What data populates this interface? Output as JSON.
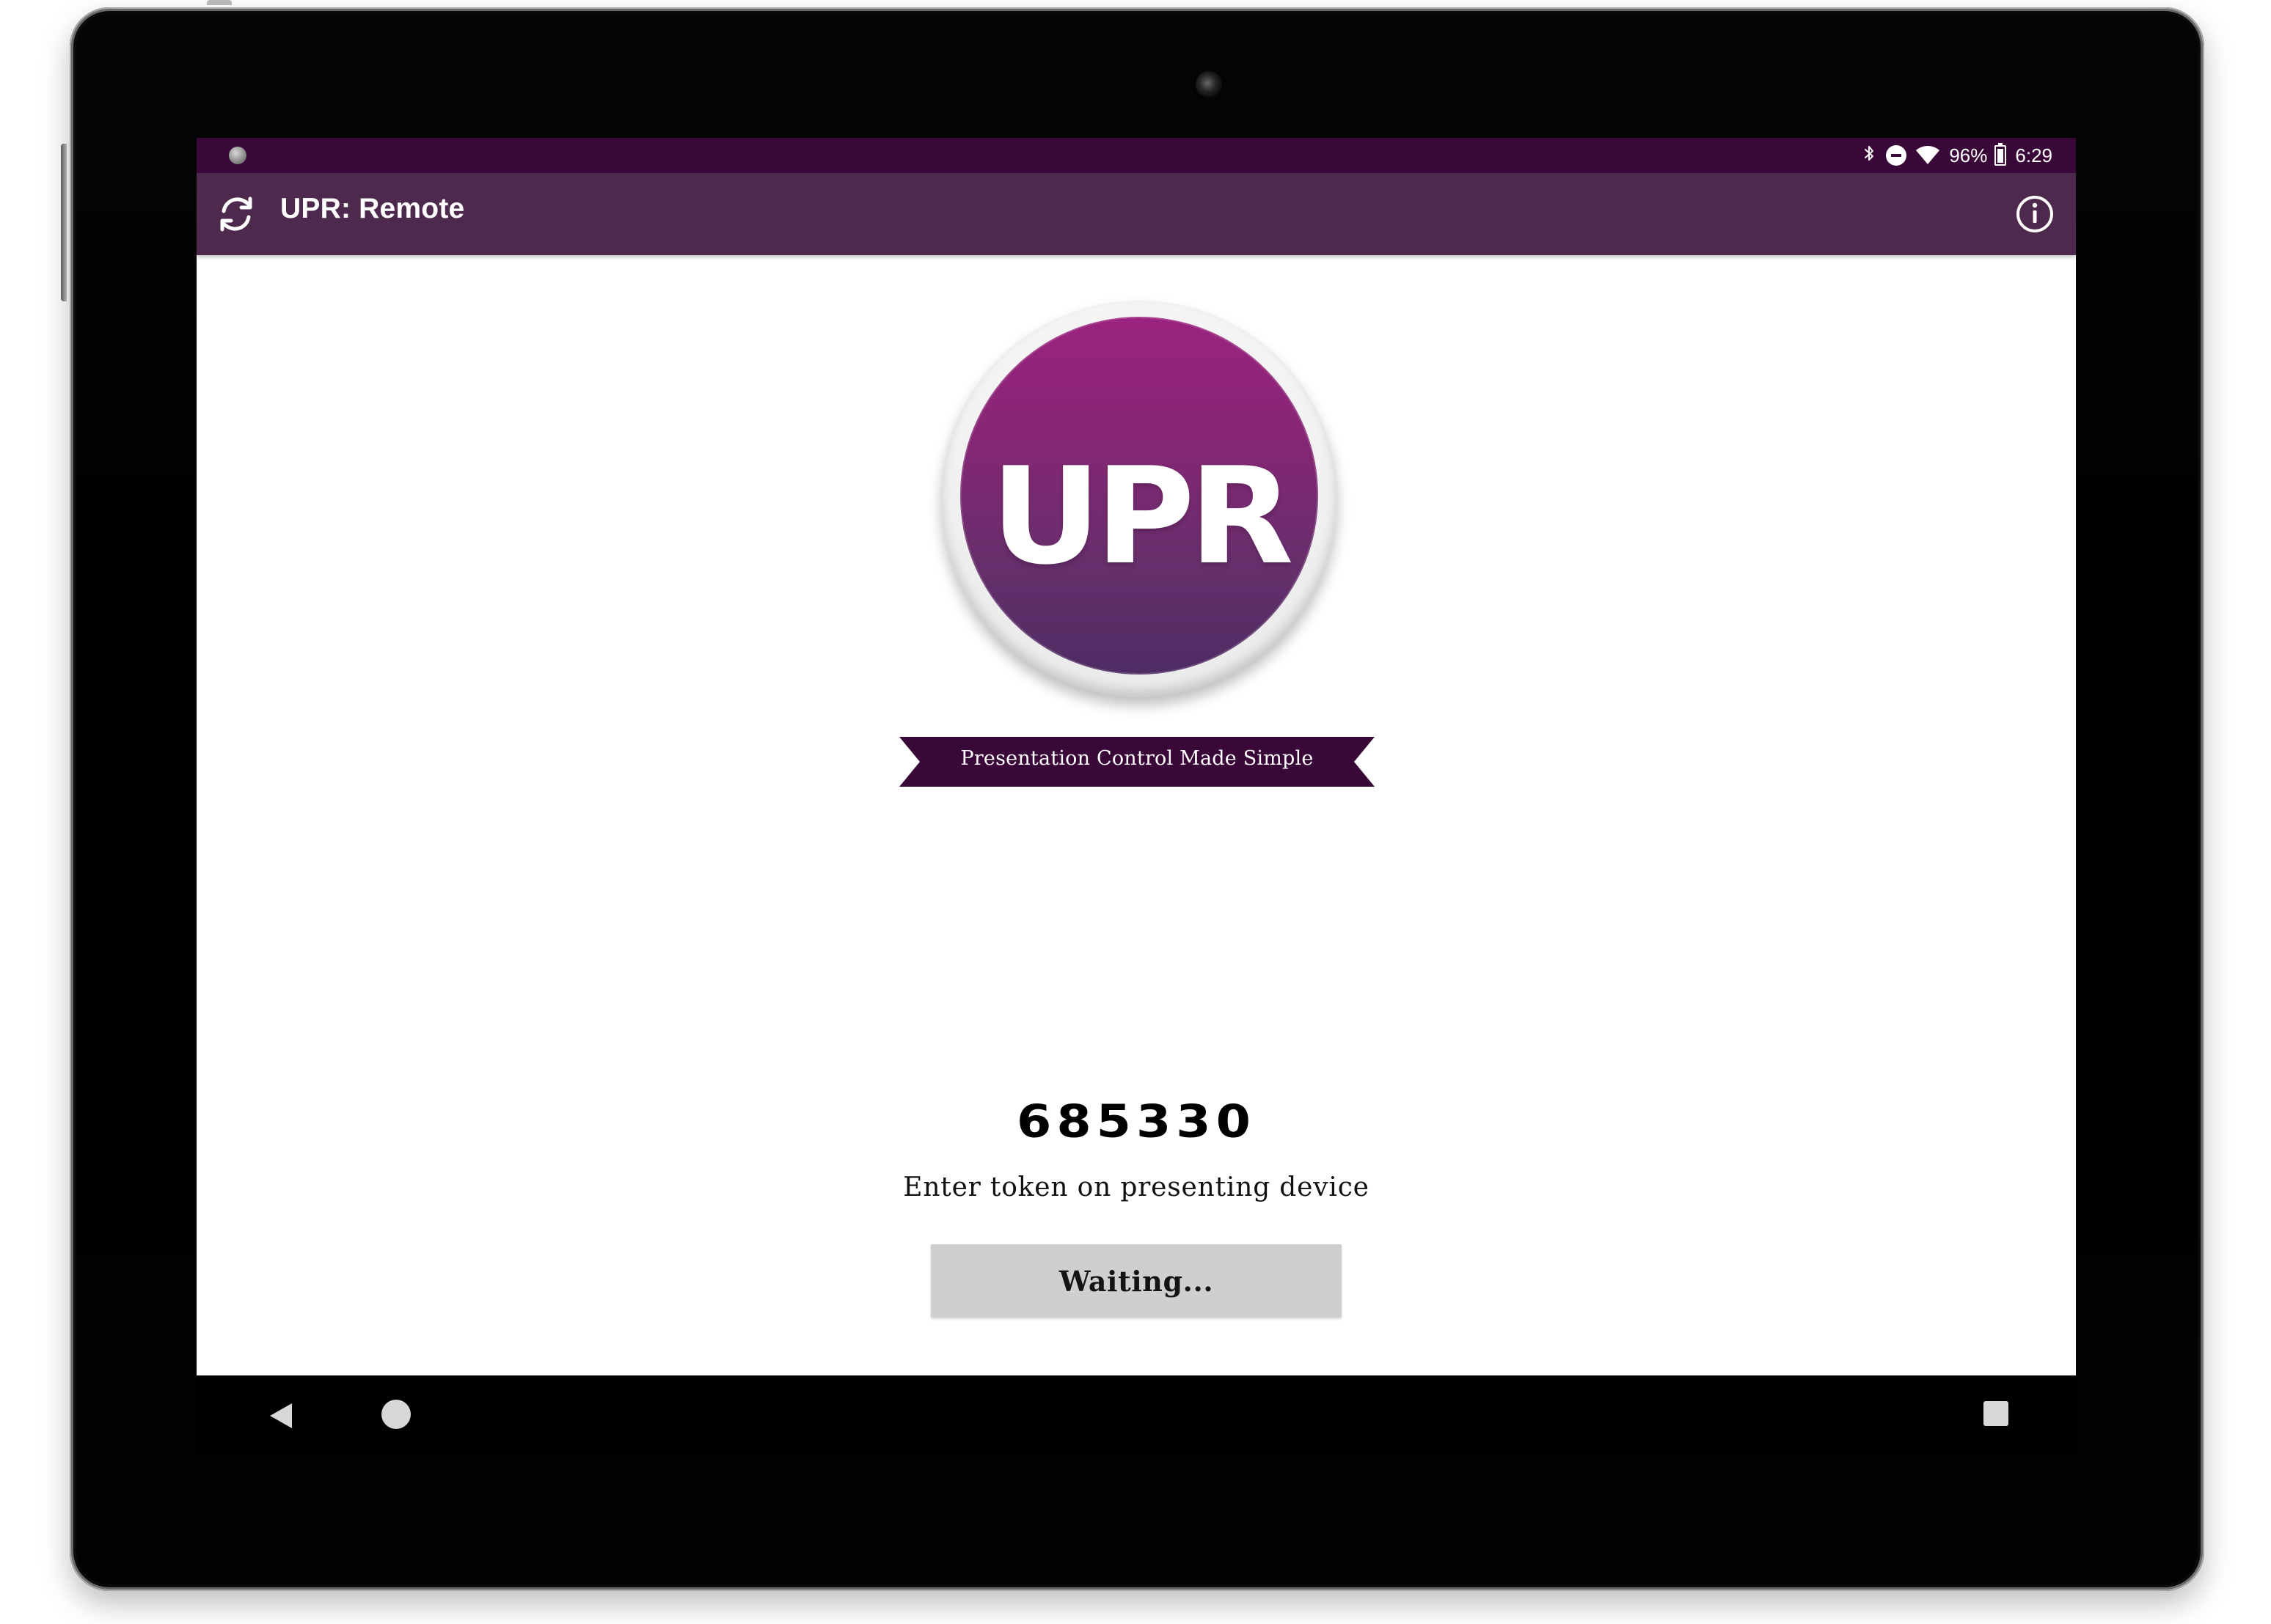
{
  "colors": {
    "status_bar": "#3a0838",
    "app_bar": "#4d2a4d",
    "logo_gradient_top": "#9a237f",
    "logo_gradient_bottom": "#4e2c63",
    "ribbon": "#3a0838",
    "button_background": "#cfcfcf"
  },
  "status_bar": {
    "battery": "96%",
    "time": "6:29",
    "icons": [
      "notification-dot-icon",
      "bluetooth-icon",
      "do-not-disturb-icon",
      "wifi-icon",
      "battery-icon"
    ]
  },
  "app_bar": {
    "title": "UPR: Remote",
    "left_icon": "refresh-icon",
    "right_icon": "info-icon"
  },
  "logo": {
    "text": "UPR"
  },
  "tagline": "Presentation Control Made Simple",
  "pairing": {
    "token": "685330",
    "instruction": "Enter token on presenting device",
    "button_label": "Waiting..."
  },
  "navigation": {
    "icons": [
      "back-icon",
      "home-icon",
      "recents-icon"
    ]
  }
}
